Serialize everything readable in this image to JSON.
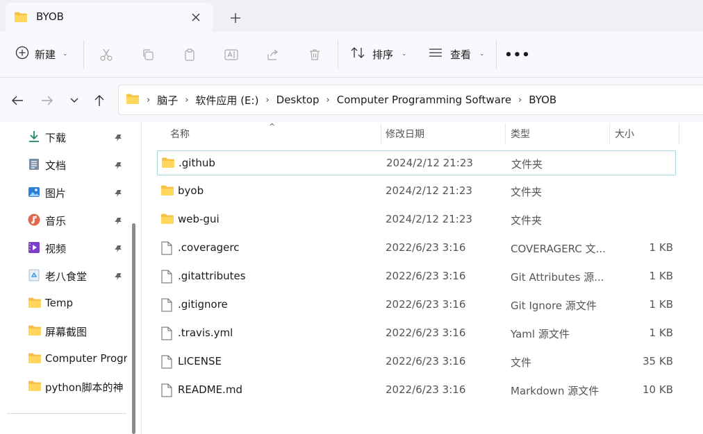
{
  "tab": {
    "title": "BYOB"
  },
  "toolbar": {
    "new_label": "新建",
    "sort_label": "排序",
    "view_label": "查看",
    "more_label": "•••"
  },
  "address": {
    "crumbs": [
      "脑子",
      "软件应用 (E:)",
      "Desktop",
      "Computer Programming Software",
      "BYOB"
    ]
  },
  "sidebar": {
    "items": [
      {
        "label": "下载",
        "icon": "download-icon",
        "pinned": true
      },
      {
        "label": "文档",
        "icon": "document-icon",
        "pinned": true
      },
      {
        "label": "图片",
        "icon": "picture-icon",
        "pinned": true
      },
      {
        "label": "音乐",
        "icon": "music-icon",
        "pinned": true
      },
      {
        "label": "视频",
        "icon": "video-icon",
        "pinned": true
      },
      {
        "label": "老八食堂",
        "icon": "recycle-icon",
        "pinned": true
      },
      {
        "label": "Temp",
        "icon": "folder-icon",
        "pinned": false
      },
      {
        "label": "屏幕截图",
        "icon": "folder-icon",
        "pinned": false
      },
      {
        "label": "Computer Progr",
        "icon": "folder-icon",
        "pinned": false
      },
      {
        "label": "python脚本的神",
        "icon": "folder-icon",
        "pinned": false
      }
    ]
  },
  "columns": {
    "name": "名称",
    "date": "修改日期",
    "type": "类型",
    "size": "大小"
  },
  "files": [
    {
      "name": ".github",
      "date": "2024/2/12 21:23",
      "type": "文件夹",
      "size": "",
      "kind": "folder"
    },
    {
      "name": "byob",
      "date": "2024/2/12 21:23",
      "type": "文件夹",
      "size": "",
      "kind": "folder"
    },
    {
      "name": "web-gui",
      "date": "2024/2/12 21:23",
      "type": "文件夹",
      "size": "",
      "kind": "folder"
    },
    {
      "name": ".coveragerc",
      "date": "2022/6/23 3:16",
      "type": "COVERAGERC 文...",
      "size": "1 KB",
      "kind": "file"
    },
    {
      "name": ".gitattributes",
      "date": "2022/6/23 3:16",
      "type": "Git Attributes 源...",
      "size": "1 KB",
      "kind": "file"
    },
    {
      "name": ".gitignore",
      "date": "2022/6/23 3:16",
      "type": "Git Ignore 源文件",
      "size": "1 KB",
      "kind": "file"
    },
    {
      "name": ".travis.yml",
      "date": "2022/6/23 3:16",
      "type": "Yaml 源文件",
      "size": "1 KB",
      "kind": "file"
    },
    {
      "name": "LICENSE",
      "date": "2022/6/23 3:16",
      "type": "文件",
      "size": "35 KB",
      "kind": "file"
    },
    {
      "name": "README.md",
      "date": "2022/6/23 3:16",
      "type": "Markdown 源文件",
      "size": "10 KB",
      "kind": "file"
    }
  ],
  "colors": {
    "folder": "#f6c244",
    "accent": "#0067c0",
    "selection_border": "#9fd8d8"
  }
}
